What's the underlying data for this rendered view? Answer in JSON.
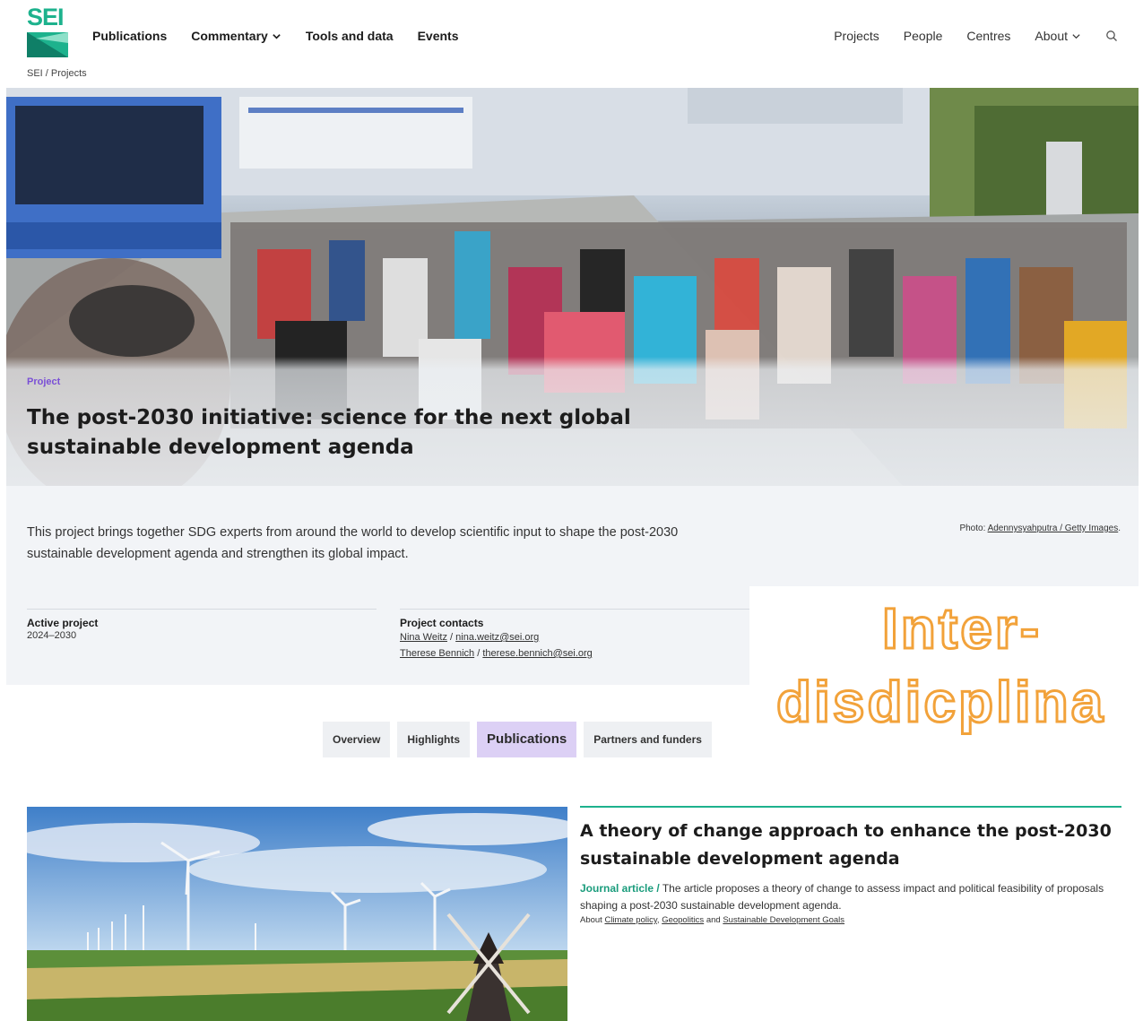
{
  "brand": {
    "logo_text": "SEI",
    "accent": "#1db28d",
    "purple": "#7a4fd6",
    "highlight": "#f2a23a"
  },
  "nav": {
    "left": [
      {
        "label": "Publications",
        "has_dropdown": false
      },
      {
        "label": "Commentary",
        "has_dropdown": true
      },
      {
        "label": "Tools and data",
        "has_dropdown": false
      },
      {
        "label": "Events",
        "has_dropdown": false
      }
    ],
    "right": [
      {
        "label": "Projects",
        "has_dropdown": false
      },
      {
        "label": "People",
        "has_dropdown": false
      },
      {
        "label": "Centres",
        "has_dropdown": false
      },
      {
        "label": "About",
        "has_dropdown": true
      }
    ],
    "search_icon": "search-icon"
  },
  "breadcrumb": "SEI / Projects",
  "hero": {
    "eyebrow": "Project",
    "title": "The post-2030 initiative: science for the next global sustainable development agenda"
  },
  "intro": {
    "lead": "This project brings together SDG experts from around the world to develop scientific input to shape the post-2030 sustainable development agenda and strengthen its global impact.",
    "credit_prefix": "Photo: ",
    "credit_link": "Adennysyahputra / Getty Images",
    "credit_suffix": ".",
    "status_label": "Active project",
    "status_value": "2024–2030",
    "contacts_label": "Project contacts",
    "contacts": [
      {
        "name": "Nina Weitz",
        "email": "nina.weitz@sei.org"
      },
      {
        "name": "Therese Bennich",
        "email": "therese.bennich@sei.org"
      }
    ],
    "contact_separator": " / "
  },
  "overlay": {
    "line1": "Inter-",
    "line2": "disdicplina"
  },
  "tabs": [
    {
      "label": "Overview",
      "active": false
    },
    {
      "label": "Highlights",
      "active": false
    },
    {
      "label": "Publications",
      "active": true
    },
    {
      "label": "Partners and funders",
      "active": false
    }
  ],
  "publication": {
    "title": "A theory of change approach to enhance the post-2030 sustainable development agenda",
    "type": "Journal article /",
    "description": "The article proposes a theory of change to assess impact and political feasibility of proposals shaping a post-2030 sustainable development agenda.",
    "topics_prefix": "About",
    "topics": [
      "Climate policy",
      "Geopolitics",
      "Sustainable Development Goals"
    ],
    "topics_sep": ", ",
    "topics_and": "and"
  }
}
